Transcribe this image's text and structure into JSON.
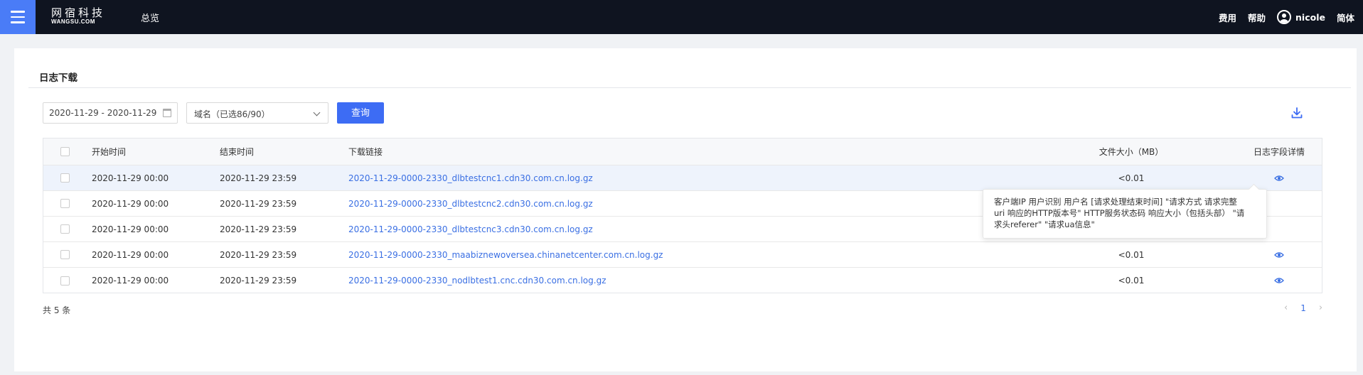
{
  "topbar": {
    "logo_cn": "网宿科技",
    "logo_en": "WANGSU.COM",
    "overview": "总览",
    "fees": "费用",
    "help": "帮助",
    "username": "nicole",
    "language": "简体"
  },
  "panel": {
    "title": "日志下载",
    "date_range": "2020-11-29 - 2020-11-29",
    "domain_select": "域名（已选86/90）",
    "query_button": "查询"
  },
  "table": {
    "headers": {
      "start": "开始时间",
      "end": "结束时间",
      "link": "下载链接",
      "size": "文件大小（MB）",
      "detail": "日志字段详情"
    },
    "rows": [
      {
        "start": "2020-11-29 00:00",
        "end": "2020-11-29 23:59",
        "link": "2020-11-29-0000-2330_dlbtestcnc1.cdn30.com.cn.log.gz",
        "size": "<0.01"
      },
      {
        "start": "2020-11-29 00:00",
        "end": "2020-11-29 23:59",
        "link": "2020-11-29-0000-2330_dlbtestcnc2.cdn30.com.cn.log.gz",
        "size": ""
      },
      {
        "start": "2020-11-29 00:00",
        "end": "2020-11-29 23:59",
        "link": "2020-11-29-0000-2330_dlbtestcnc3.cdn30.com.cn.log.gz",
        "size": ""
      },
      {
        "start": "2020-11-29 00:00",
        "end": "2020-11-29 23:59",
        "link": "2020-11-29-0000-2330_maabiznewoversea.chinanetcenter.com.cn.log.gz",
        "size": "<0.01"
      },
      {
        "start": "2020-11-29 00:00",
        "end": "2020-11-29 23:59",
        "link": "2020-11-29-0000-2330_nodlbtest1.cnc.cdn30.com.cn.log.gz",
        "size": "<0.01"
      }
    ]
  },
  "tooltip": {
    "line1": "客户端IP 用户识别 用户名 [请求处理结束时间] \"请求方式 请求完整",
    "line2": "uri 响应的HTTP版本号\" HTTP服务状态码 响应大小（包括头部） \"请",
    "line3": "求头referer\" \"请求ua信息\""
  },
  "footer": {
    "total": "共 5 条",
    "page": "1"
  },
  "colors": {
    "topbar_bg": "#0f1420",
    "menu_accent": "#4a7cf7",
    "primary_button": "#3d6cf4",
    "link": "#3a6fe3"
  }
}
